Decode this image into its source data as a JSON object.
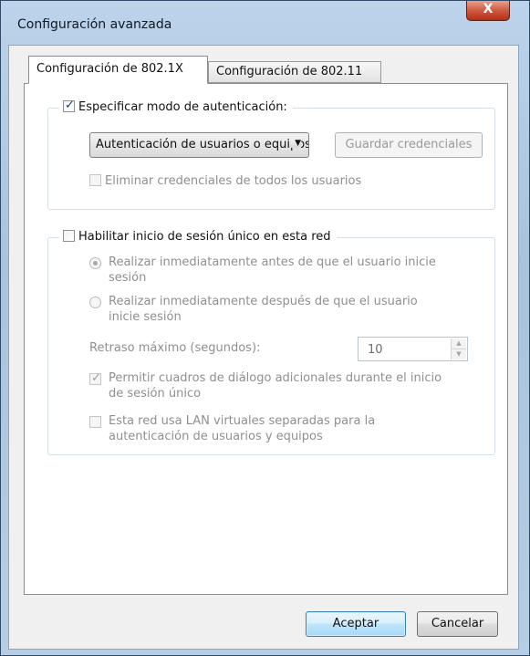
{
  "window": {
    "title": "Configuración avanzada",
    "close_glyph": "X"
  },
  "tabs": [
    {
      "label": "Configuración de 802.1X",
      "active": true
    },
    {
      "label": "Configuración de 802.11",
      "active": false
    }
  ],
  "auth_group": {
    "specify_mode_label": "Especificar modo de autenticación:",
    "specify_mode_checked": true,
    "auth_mode_value": "Autenticación de usuarios o equipos",
    "save_credentials_label": "Guardar credenciales",
    "delete_credentials_label": "Eliminar credenciales de todos los usuarios",
    "delete_credentials_checked": false
  },
  "sso_group": {
    "enable_sso_label": "Habilitar inicio de sesión único en esta red",
    "enable_sso_checked": false,
    "radio_before_line1": "Realizar inmediatamente antes de que el usuario inicie",
    "radio_before_line2": "sesión",
    "radio_before_selected": true,
    "radio_after_line1": "Realizar inmediatamente después de que el usuario",
    "radio_after_line2": "inicie sesión",
    "radio_after_selected": false,
    "max_delay_label": "Retraso máximo (segundos):",
    "max_delay_value": "10",
    "allow_dialogs_line1": "Permitir cuadros de diálogo adicionales durante el inicio",
    "allow_dialogs_line2": "de sesión único",
    "allow_dialogs_checked": true,
    "vlan_line1": "Esta red usa LAN virtuales separadas para la",
    "vlan_line2": "autenticación de usuarios y equipos",
    "vlan_checked": false
  },
  "buttons": {
    "ok": "Aceptar",
    "cancel": "Cancelar"
  },
  "colors": {
    "title_bar": "#bcd3ea",
    "close_button": "#cf5a3e",
    "disabled_text": "#8f8f8f",
    "default_button": "#bee6fd"
  }
}
